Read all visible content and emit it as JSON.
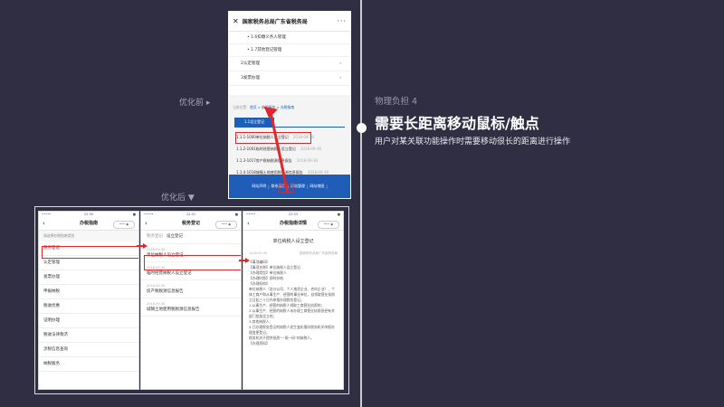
{
  "before": {
    "title": "国家税务总局广东省税务局",
    "close": "✕",
    "more": "···",
    "sub_items": [
      "• 1.6扣缴义务人管理",
      "• 1.7其他登记管理"
    ],
    "menus": [
      {
        "label": "2认定管理",
        "chev": "›"
      },
      {
        "label": "3发票办理",
        "chev": "›"
      }
    ],
    "crumb_prefix": "当前位置：",
    "crumb_path": "首页 > 纳税服务 > 办税指南",
    "tab": "1.1设立登记",
    "items": [
      {
        "name": "1.1.1-1000单位纳税人设立登记",
        "date": "2018-09-30"
      },
      {
        "name": "1.1.2-1001临时经营纳税人设立登记",
        "date": "2018-09-30"
      },
      {
        "name": "1.1.3-1017房产税纳税源信息报告",
        "date": "2018-09-30"
      },
      {
        "name": "1.1.4-1018城镇土地使用税税源信息报告",
        "date": "2018-09-30"
      }
    ],
    "footer": [
      "网站声明",
      "|",
      "联系我们",
      "|",
      "网站管理",
      "|",
      "网站地图",
      "|"
    ]
  },
  "labels": {
    "before": "优化前 ▸",
    "after": "优化后 ▼",
    "subtitle": "物理负担 4",
    "headline": "需要长距离移动鼠标/触点",
    "desc": "用户对某关联功能操作时需要移动很长的距离进行操作"
  },
  "phone1": {
    "time": "22:50",
    "signal": "•••••",
    "battery": "■",
    "title": "办税指南",
    "back": "‹",
    "capsule": "••• ◉",
    "hint": "请选择办税指南类别",
    "items": [
      "税务登记",
      "认定管理",
      "发票办理",
      "申报纳税",
      "税收优惠",
      "证明办理",
      "税收法律救济",
      "涉税信息查询",
      "纳税服务"
    ]
  },
  "phone2": {
    "time": "22:51",
    "signal": "•••••",
    "battery": "■",
    "title": "税务登记",
    "back": "‹",
    "capsule": "••• ◉",
    "hdr_gray": "税务登记",
    "hdr": "设立登记",
    "items": [
      {
        "date": "2018-09-30",
        "name": "单位纳税人设立登记"
      },
      {
        "date": "2018-09-30",
        "name": "临时经营纳税人设立登记"
      },
      {
        "date": "2018-09-30",
        "name": "房产税税源信息报告"
      },
      {
        "date": "2018-09-30",
        "name": "城镇土地使用税税源信息报告"
      }
    ]
  },
  "phone3": {
    "time": "22:53",
    "signal": "•••••",
    "battery": "■",
    "title": "办税指南详情",
    "back": "‹",
    "capsule": "••• ◉",
    "doc_title": "单位纳税人设立登记",
    "date": "2018-09-30",
    "source": "国家税务总局广东省税务局",
    "body": [
      "【事项编码】",
      "",
      "【事项名称】单位纳税人设立登记",
      "【办理类型】单位纳税人",
      "【办理时限】即时办结",
      "【办理机构】",
      "",
      "单位纳税人（含分公司、个人独资企业、合伙企业）、个体工商户和从事生产、经营的事业单位，自领取营业执照之日起三十日内申报办理税务登记。",
      "1.从事生产、经营的纳税人领取工商营业执照的；",
      "2.从事生产、经营的纳税人未办理工商营业执照但经有关部门批准设立的；",
      "3.其他纳税人；",
      "4.已办理税务登记的纳税人发生变化需向税务机关申报办理变更登记。",
      "税务机关不提供纸质\"一照一码\"的纳税人。",
      "【办理资料】"
    ]
  },
  "colors": {
    "bg": "#2f2e43",
    "accent": "#e2262b",
    "brand_blue": "#1d5fb5"
  }
}
